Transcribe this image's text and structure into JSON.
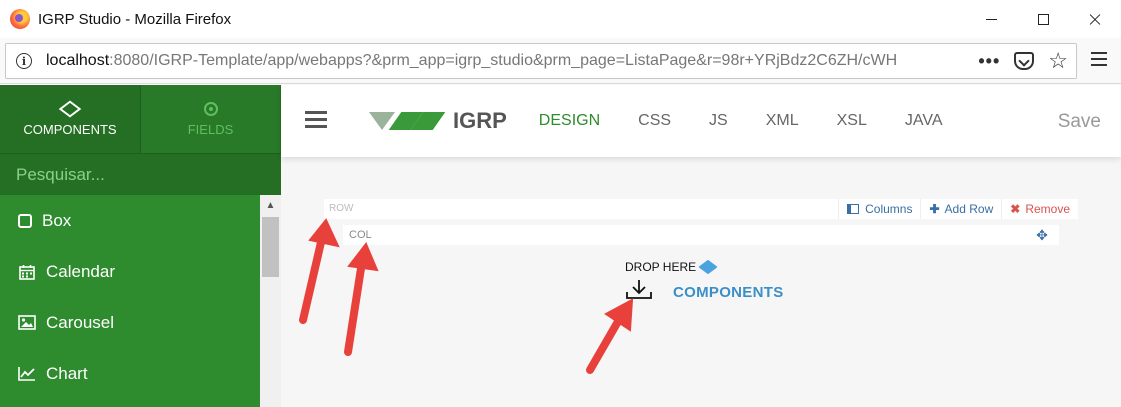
{
  "window": {
    "title": "IGRP Studio - Mozilla Firefox"
  },
  "address_bar": {
    "host": "localhost",
    "path": ":8080/IGRP-Template/app/webapps?&prm_app=igrp_studio&prm_page=ListaPage&r=98r+YRjBdz2C6ZH/cWH"
  },
  "sidebar": {
    "tabs": [
      {
        "label": "COMPONENTS",
        "icon": "cube-icon",
        "active": true
      },
      {
        "label": "FIELDS",
        "icon": "target-icon",
        "active": false
      }
    ],
    "search_placeholder": "Pesquisar...",
    "items": [
      {
        "label": "Box",
        "icon": "square-icon"
      },
      {
        "label": "Calendar",
        "icon": "calendar-icon"
      },
      {
        "label": "Carousel",
        "icon": "image-icon"
      },
      {
        "label": "Chart",
        "icon": "line-chart-icon"
      }
    ]
  },
  "appbar": {
    "logo_text": "IGRP",
    "tabs": [
      {
        "label": "DESIGN",
        "active": true
      },
      {
        "label": "CSS",
        "active": false
      },
      {
        "label": "JS",
        "active": false
      },
      {
        "label": "XML",
        "active": false
      },
      {
        "label": "XSL",
        "active": false
      },
      {
        "label": "JAVA",
        "active": false
      }
    ],
    "save_label": "Save"
  },
  "canvas": {
    "row_label": "ROW",
    "row_actions": {
      "columns": "Columns",
      "add_row": "Add Row",
      "remove": "Remove"
    },
    "col_label": "COL",
    "drop_here": "DROP HERE",
    "drop_components": "COMPONENTS"
  },
  "colors": {
    "sidebar_green": "#2e8b2e",
    "accent_blue": "#3a8fc8",
    "remove_red": "#d9534f",
    "annotation_red": "#e8413c"
  }
}
